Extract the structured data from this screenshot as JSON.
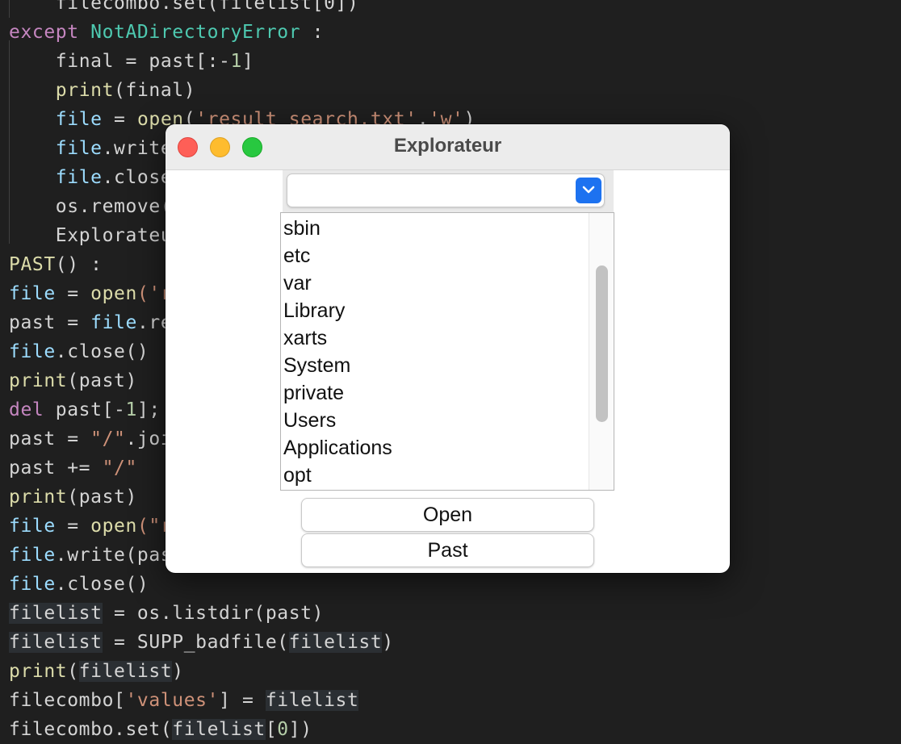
{
  "editor": {
    "lines": [
      {
        "indent": "    ",
        "segments": [
          {
            "t": "filecombo.set(filelist[0])",
            "c": "plain"
          }
        ]
      },
      {
        "indent": "",
        "segments": [
          {
            "t": "except ",
            "c": "kw"
          },
          {
            "t": "NotADirectoryError",
            "c": "cls"
          },
          {
            "t": " :",
            "c": "plain"
          }
        ]
      },
      {
        "indent": "    ",
        "segments": [
          {
            "t": "final = past[:-",
            "c": "plain"
          },
          {
            "t": "1",
            "c": "num"
          },
          {
            "t": "]",
            "c": "plain"
          }
        ]
      },
      {
        "indent": "    ",
        "segments": [
          {
            "t": "print",
            "c": "fn"
          },
          {
            "t": "(final)",
            "c": "plain"
          }
        ]
      },
      {
        "indent": "    ",
        "segments": [
          {
            "t": "file",
            "c": "var"
          },
          {
            "t": " = ",
            "c": "plain"
          },
          {
            "t": "open",
            "c": "fn"
          },
          {
            "t": "(",
            "c": "plain"
          },
          {
            "t": "'result_search.txt'",
            "c": "str"
          },
          {
            "t": ",",
            "c": "plain"
          },
          {
            "t": "'w'",
            "c": "str"
          },
          {
            "t": ")",
            "c": "plain"
          }
        ]
      },
      {
        "indent": "    ",
        "segments": [
          {
            "t": "file",
            "c": "var"
          },
          {
            "t": ".write",
            "c": "plain"
          }
        ]
      },
      {
        "indent": "    ",
        "segments": [
          {
            "t": "file",
            "c": "var"
          },
          {
            "t": ".close",
            "c": "plain"
          }
        ]
      },
      {
        "indent": "    ",
        "segments": [
          {
            "t": "os.remove(",
            "c": "plain"
          }
        ]
      },
      {
        "indent": "    ",
        "segments": [
          {
            "t": "Explorateu",
            "c": "plain"
          }
        ]
      },
      {
        "indent": "",
        "segments": [
          {
            "t": "PAST",
            "c": "fn"
          },
          {
            "t": "() :",
            "c": "plain"
          }
        ]
      },
      {
        "indent": "",
        "segments": [
          {
            "t": "file",
            "c": "var"
          },
          {
            "t": " = ",
            "c": "plain"
          },
          {
            "t": "open",
            "c": "fn"
          },
          {
            "t": "('r",
            "c": "str"
          }
        ]
      },
      {
        "indent": "",
        "segments": [
          {
            "t": "past = ",
            "c": "plain"
          },
          {
            "t": "file",
            "c": "var"
          },
          {
            "t": ".re",
            "c": "plain"
          }
        ]
      },
      {
        "indent": "",
        "segments": [
          {
            "t": "file",
            "c": "var"
          },
          {
            "t": ".close()",
            "c": "plain"
          }
        ]
      },
      {
        "indent": "",
        "segments": [
          {
            "t": "print",
            "c": "fn"
          },
          {
            "t": "(past)",
            "c": "plain"
          }
        ]
      },
      {
        "indent": "",
        "segments": [
          {
            "t": "del",
            "c": "kw"
          },
          {
            "t": " past[-",
            "c": "plain"
          },
          {
            "t": "1",
            "c": "num"
          },
          {
            "t": "];",
            "c": "plain"
          }
        ]
      },
      {
        "indent": "",
        "segments": [
          {
            "t": "past = ",
            "c": "plain"
          },
          {
            "t": "\"/\"",
            "c": "str"
          },
          {
            "t": ".joi",
            "c": "plain"
          }
        ]
      },
      {
        "indent": "",
        "segments": [
          {
            "t": "past += ",
            "c": "plain"
          },
          {
            "t": "\"/\"",
            "c": "str"
          }
        ]
      },
      {
        "indent": "",
        "segments": [
          {
            "t": "print",
            "c": "fn"
          },
          {
            "t": "(past)",
            "c": "plain"
          }
        ]
      },
      {
        "indent": "",
        "segments": [
          {
            "t": "file",
            "c": "var"
          },
          {
            "t": " = ",
            "c": "plain"
          },
          {
            "t": "open",
            "c": "fn"
          },
          {
            "t": "(\"r",
            "c": "str"
          }
        ]
      },
      {
        "indent": "",
        "segments": [
          {
            "t": "file",
            "c": "var"
          },
          {
            "t": ".write(pas",
            "c": "plain"
          }
        ]
      },
      {
        "indent": "",
        "segments": [
          {
            "t": "file",
            "c": "var"
          },
          {
            "t": ".close()",
            "c": "plain"
          }
        ]
      },
      {
        "indent": "",
        "segments": [
          {
            "t": "filelist",
            "c": "plain",
            "hl": true
          },
          {
            "t": " = os.listdir(past)",
            "c": "plain"
          }
        ]
      },
      {
        "indent": "",
        "segments": [
          {
            "t": "filelist",
            "c": "plain",
            "hl": true
          },
          {
            "t": " = SUPP_badfile(",
            "c": "plain"
          },
          {
            "t": "filelist",
            "c": "plain",
            "hl": true
          },
          {
            "t": ")",
            "c": "plain"
          }
        ]
      },
      {
        "indent": "",
        "segments": [
          {
            "t": "print",
            "c": "fn"
          },
          {
            "t": "(",
            "c": "plain"
          },
          {
            "t": "filelist",
            "c": "plain",
            "hl": true
          },
          {
            "t": ")",
            "c": "plain"
          }
        ]
      },
      {
        "indent": "",
        "segments": [
          {
            "t": "filecombo[",
            "c": "plain"
          },
          {
            "t": "'values'",
            "c": "str"
          },
          {
            "t": "] = ",
            "c": "plain"
          },
          {
            "t": "filelist",
            "c": "plain",
            "hl": true
          }
        ]
      },
      {
        "indent": "",
        "segments": [
          {
            "t": "filecombo.set(",
            "c": "plain"
          },
          {
            "t": "filelist",
            "c": "plain",
            "hl": true
          },
          {
            "t": "[",
            "c": "plain"
          },
          {
            "t": "0",
            "c": "num"
          },
          {
            "t": "])",
            "c": "plain"
          }
        ]
      }
    ]
  },
  "window": {
    "title": "Explorateur",
    "combobox": {
      "value": ""
    },
    "listbox": {
      "items": [
        "sbin",
        "etc",
        "var",
        "Library",
        "xarts",
        "System",
        "private",
        "Users",
        "Applications",
        "opt"
      ]
    },
    "buttons": {
      "open_label": "Open",
      "past_label": "Past"
    }
  },
  "colors": {
    "editor_bg": "#1f1f1f",
    "keyword": "#c586c0",
    "class": "#4ec9b0",
    "function": "#dcdcaa",
    "variable": "#9cdcfe",
    "string": "#ce9178",
    "number": "#b5cea8",
    "close": "#fe5f57",
    "minimize": "#febc2e",
    "maximize": "#28c840",
    "accent": "#1d72f0"
  },
  "icons": {
    "combo_arrow": "chevron-down-icon"
  }
}
